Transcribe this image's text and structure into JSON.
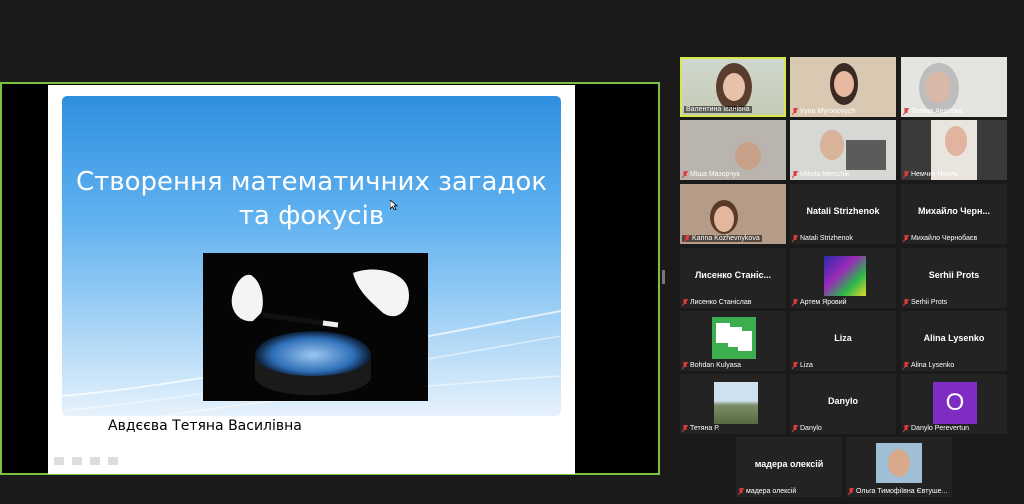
{
  "slide": {
    "title_line1": "Створення математичних загадок",
    "title_line2": "та фокусів",
    "author": "Авдєєва Тетяна Василівна"
  },
  "participants": [
    {
      "label": "Валентина Іванівна",
      "big": "",
      "active": true
    },
    {
      "label": "Iryna Myronovych",
      "big": ""
    },
    {
      "label": "Тетяна Авдєєва",
      "big": ""
    },
    {
      "label": "Міша Мазорчук",
      "big": ""
    },
    {
      "label": "Mikela Nemchik",
      "big": ""
    },
    {
      "label": "Немчик Ніколь",
      "big": ""
    },
    {
      "label": "Karina Kozhevnykova",
      "big": ""
    },
    {
      "label": "Natali Strizhenok",
      "big": "Natali Strizhenok"
    },
    {
      "label": "Михайло Чернобаєв",
      "big": "Михайло Черн..."
    },
    {
      "label": "Лисенко Станіслав",
      "big": "Лисенко Станіс..."
    },
    {
      "label": "Артем Яровий",
      "big": ""
    },
    {
      "label": "Serhii Prots",
      "big": "Serhii Prots"
    },
    {
      "label": "Bohdan Kulyasa",
      "big": ""
    },
    {
      "label": "Liza",
      "big": "Liza"
    },
    {
      "label": "Alina Lysenko",
      "big": "Alina Lysenko"
    },
    {
      "label": "Тетяна Р.",
      "big": ""
    },
    {
      "label": "Danylo",
      "big": "Danylo"
    },
    {
      "label": "Danylo Perevertun",
      "big": "O"
    },
    {
      "label": "мадера олексій",
      "big": "мадера олексій"
    },
    {
      "label": "Ольга Тимофіївна Євтуше...",
      "big": ""
    }
  ]
}
